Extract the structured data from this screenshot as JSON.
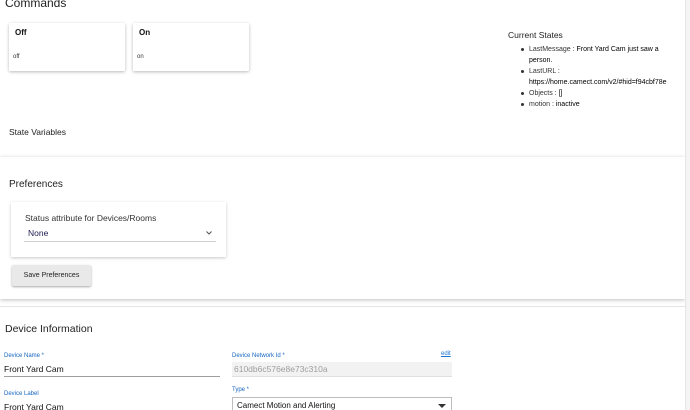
{
  "commands": {
    "title": "Commands",
    "tiles": [
      {
        "label": "Off",
        "sublabel": "off"
      },
      {
        "label": "On",
        "sublabel": "on"
      }
    ]
  },
  "current_states": {
    "title": "Current States",
    "items": [
      {
        "key": "LastMessage",
        "value": "Front Yard Cam just saw a person."
      },
      {
        "key": "LastURL",
        "value": "https://home.camect.com/v2/#hid=f94cbf78e"
      },
      {
        "key": "Objects",
        "value": "[]"
      },
      {
        "key": "motion",
        "value": "inactive"
      }
    ]
  },
  "state_variables": {
    "title": "State Variables"
  },
  "preferences": {
    "title": "Preferences",
    "status_attribute": {
      "label": "Status attribute for Devices/Rooms",
      "value": "None"
    },
    "save_label": "Save Preferences"
  },
  "device_info": {
    "title": "Device Information",
    "device_name": {
      "label": "Device Name *",
      "value": "Front Yard Cam"
    },
    "device_network_id": {
      "label": "Device Network Id *",
      "value": "610db6c576e8e73c310a",
      "edit_label": "edit"
    },
    "device_label": {
      "label": "Device Label",
      "value": "Front Yard Cam"
    },
    "type": {
      "label": "Type *",
      "value": "Camect Motion and Alerting"
    }
  },
  "colors": {
    "accent": "#1565c0",
    "link": "#1976d2"
  }
}
